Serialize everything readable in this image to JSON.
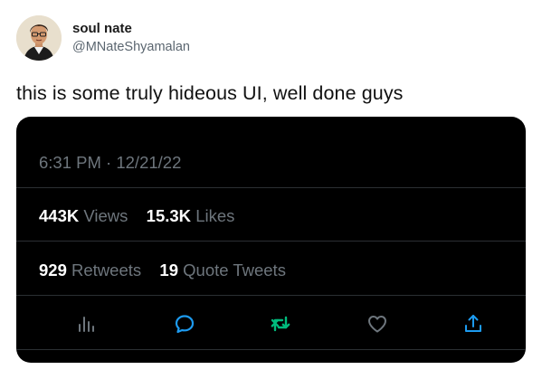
{
  "author": {
    "name": "soul nate",
    "handle": "@MNateShyamalan"
  },
  "tweet": {
    "text": "this is some truly hideous UI, well done guys"
  },
  "card": {
    "time": "6:31 PM",
    "separator": "·",
    "date": "12/21/22",
    "views_count": "443K",
    "views_label": "Views",
    "likes_count": "15.3K",
    "likes_label": "Likes",
    "retweets_count": "929",
    "retweets_label": "Retweets",
    "quotes_count": "19",
    "quotes_label": "Quote Tweets"
  },
  "actions": [
    {
      "icon": "analytics-icon",
      "color": "#6e767d"
    },
    {
      "icon": "reply-icon",
      "color": "#1d9bf0"
    },
    {
      "icon": "retweet-icon",
      "color": "#00ba7c"
    },
    {
      "icon": "like-icon",
      "color": "#6e767d"
    },
    {
      "icon": "share-icon",
      "color": "#1d9bf0"
    }
  ],
  "colors": {
    "card_background": "#000000",
    "muted_text": "#6e767d",
    "blue": "#1d9bf0",
    "green": "#00ba7c"
  }
}
